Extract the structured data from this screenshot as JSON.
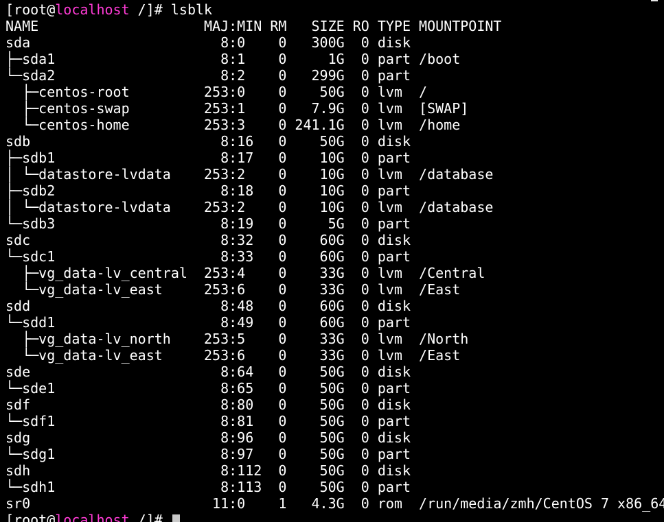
{
  "colors": {
    "background": "#000000",
    "text": "#ffffff",
    "hostname": "#ff3bd6",
    "cursor": "#c8c8c8"
  },
  "prompt": {
    "open": "[",
    "user": "root",
    "at": "@",
    "host": "localhost",
    "path": " /",
    "close": "]# "
  },
  "command": "lsblk",
  "output_lines": [
    "NAME                    MAJ:MIN RM   SIZE RO TYPE MOUNTPOINT",
    "sda                       8:0    0   300G  0 disk ",
    "├─sda1                    8:1    0     1G  0 part /boot",
    "└─sda2                    8:2    0   299G  0 part ",
    "  ├─centos-root         253:0    0    50G  0 lvm  /",
    "  ├─centos-swap         253:1    0   7.9G  0 lvm  [SWAP]",
    "  └─centos-home         253:3    0 241.1G  0 lvm  /home",
    "sdb                       8:16   0    50G  0 disk ",
    "├─sdb1                    8:17   0    10G  0 part ",
    "│ └─datastore-lvdata    253:2    0    10G  0 lvm  /database",
    "├─sdb2                    8:18   0    10G  0 part ",
    "│ └─datastore-lvdata    253:2    0    10G  0 lvm  /database",
    "└─sdb3                    8:19   0     5G  0 part ",
    "sdc                       8:32   0    60G  0 disk ",
    "└─sdc1                    8:33   0    60G  0 part ",
    "  ├─vg_data-lv_central  253:4    0    33G  0 lvm  /Central",
    "  └─vg_data-lv_east     253:6    0    33G  0 lvm  /East",
    "sdd                       8:48   0    60G  0 disk ",
    "└─sdd1                    8:49   0    60G  0 part ",
    "  ├─vg_data-lv_north    253:5    0    33G  0 lvm  /North",
    "  └─vg_data-lv_east     253:6    0    33G  0 lvm  /East",
    "sde                       8:64   0    50G  0 disk ",
    "└─sde1                    8:65   0    50G  0 part ",
    "sdf                       8:80   0    50G  0 disk ",
    "└─sdf1                    8:81   0    50G  0 part ",
    "sdg                       8:96   0    50G  0 disk ",
    "└─sdg1                    8:97   0    50G  0 part ",
    "sdh                       8:112  0    50G  0 disk ",
    "└─sdh1                    8:113  0    50G  0 part ",
    "sr0                      11:0    1   4.3G  0 rom  /run/media/zmh/CentOS 7 x86_64"
  ]
}
